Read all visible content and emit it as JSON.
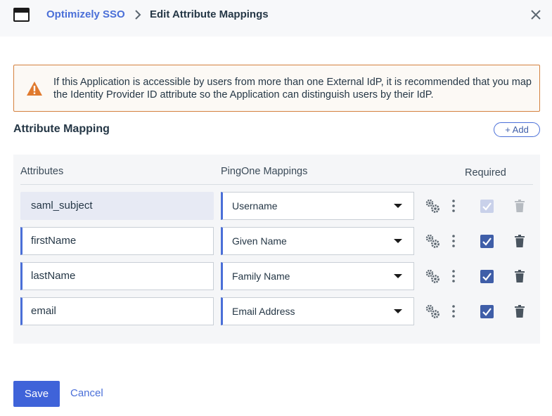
{
  "header": {
    "app_icon": "window-icon",
    "breadcrumb_link": "Optimizely SSO",
    "title": "Edit Attribute Mappings",
    "close_icon": "close-icon"
  },
  "warning": {
    "icon": "warning-triangle-icon",
    "color": "#d4813e",
    "text": "If this Application is accessible by users from more than one External IdP, it is recommended that you map the Identity Provider ID attribute so the Application can distinguish users by their IdP."
  },
  "section": {
    "title": "Attribute Mapping",
    "add_label": "+ Add"
  },
  "table": {
    "headers": {
      "attributes": "Attributes",
      "mappings": "PingOne Mappings",
      "required": "Required"
    },
    "rows": [
      {
        "attribute": "saml_subject",
        "mapping": "Username",
        "required": true,
        "locked": true
      },
      {
        "attribute": "firstName",
        "mapping": "Given Name",
        "required": true,
        "locked": false
      },
      {
        "attribute": "lastName",
        "mapping": "Family Name",
        "required": true,
        "locked": false
      },
      {
        "attribute": "email",
        "mapping": "Email Address",
        "required": true,
        "locked": false
      }
    ]
  },
  "footer": {
    "save_label": "Save",
    "cancel_label": "Cancel"
  },
  "colors": {
    "accent": "#4a6fd8",
    "primary_button": "#3f63d9",
    "checkbox": "#3f5ea8"
  }
}
